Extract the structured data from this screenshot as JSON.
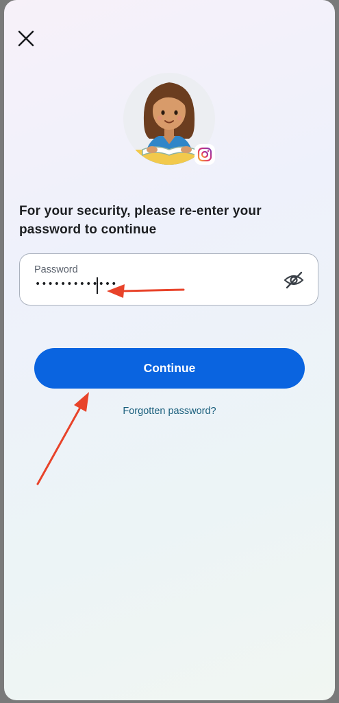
{
  "dialog": {
    "heading": "For your security, please re-enter your password to continue"
  },
  "close": {
    "icon": "close-icon"
  },
  "avatar": {
    "badge_icon": "instagram-icon"
  },
  "password_field": {
    "label": "Password",
    "value": "•••••••••••••",
    "visibility_icon": "eye-off-icon"
  },
  "actions": {
    "continue_label": "Continue",
    "forgot_label": "Forgotten password?"
  },
  "colors": {
    "primary": "#0a64e0",
    "link": "#195e7c",
    "annotation_arrow": "#e8432a"
  }
}
